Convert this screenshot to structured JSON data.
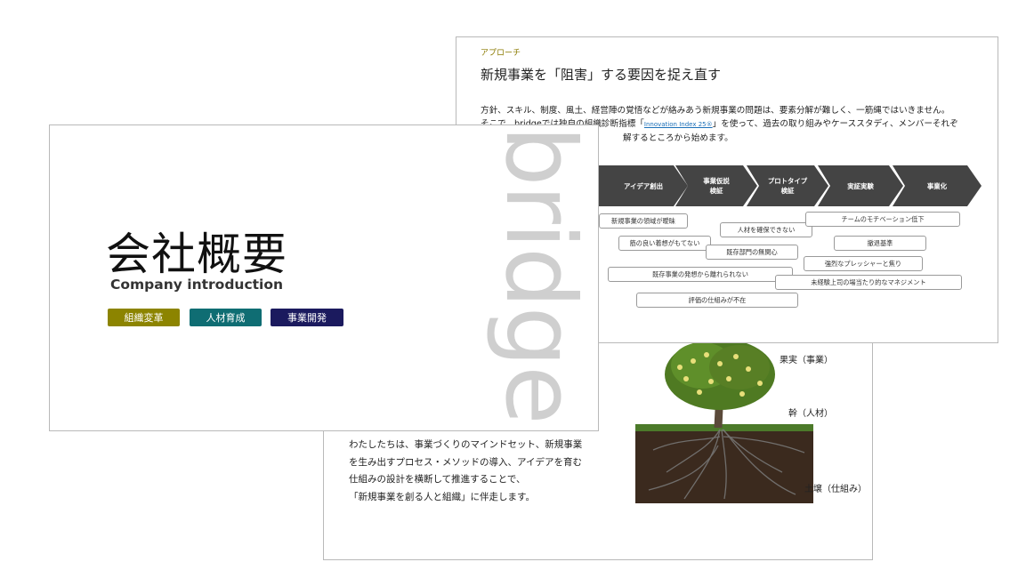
{
  "back_slide": {
    "text_lines": [
      "わたしたちは、事業づくりのマインドセット、新規事業",
      "を生み出すプロセス・メソッドの導入、アイデアを育む",
      "仕組みの設計を横断して推進することで、",
      "「新規事業を創る人と組織」に伴走します。"
    ],
    "tree_labels": {
      "fruit": "果実（事業）",
      "trunk": "幹（人材）",
      "soil": "土壌（仕組み）"
    }
  },
  "mid_slide": {
    "eyebrow": "アプローチ",
    "title": "新規事業を「阻害」する要因を捉え直す",
    "body_line1": "方針、スキル、制度、風土、経営陣の覚悟などが絡みあう新規事業の問題は、要素分解が難しく、一筋縄ではいきません。",
    "body_line2_a": "そこで、bridgeでは独自の組織診断指標「",
    "body_line2_link": "Innovation Index 25®",
    "body_line2_b": "」を使って、過去の取り組みやケーススタディ、メンバーそれぞ",
    "body_line3": "解するところから始めます。",
    "stages": [
      "アイデア創出",
      "事業仮説\n検証",
      "プロトタイプ\n検証",
      "実証実験",
      "事業化"
    ],
    "stage_color": "#444444",
    "barriers": [
      "新規事業の領域が曖昧",
      "筋の良い着想がもてない",
      "既存事業の発想から離れられない",
      "評価の仕組みが不在",
      "人材を確保できない",
      "既存部門の無関心",
      "チームのモチベーション低下",
      "撤退基準",
      "強烈なプレッシャーと焦り",
      "未経験上司の場当たり的なマネジメント"
    ]
  },
  "front_slide": {
    "title": "会社概要",
    "subtitle": "Company introduction",
    "watermark": "bridge",
    "tags": [
      {
        "label": "組織変革",
        "color": "#8c8400"
      },
      {
        "label": "人材育成",
        "color": "#0f6d73"
      },
      {
        "label": "事業開発",
        "color": "#1b1a5e"
      }
    ]
  }
}
